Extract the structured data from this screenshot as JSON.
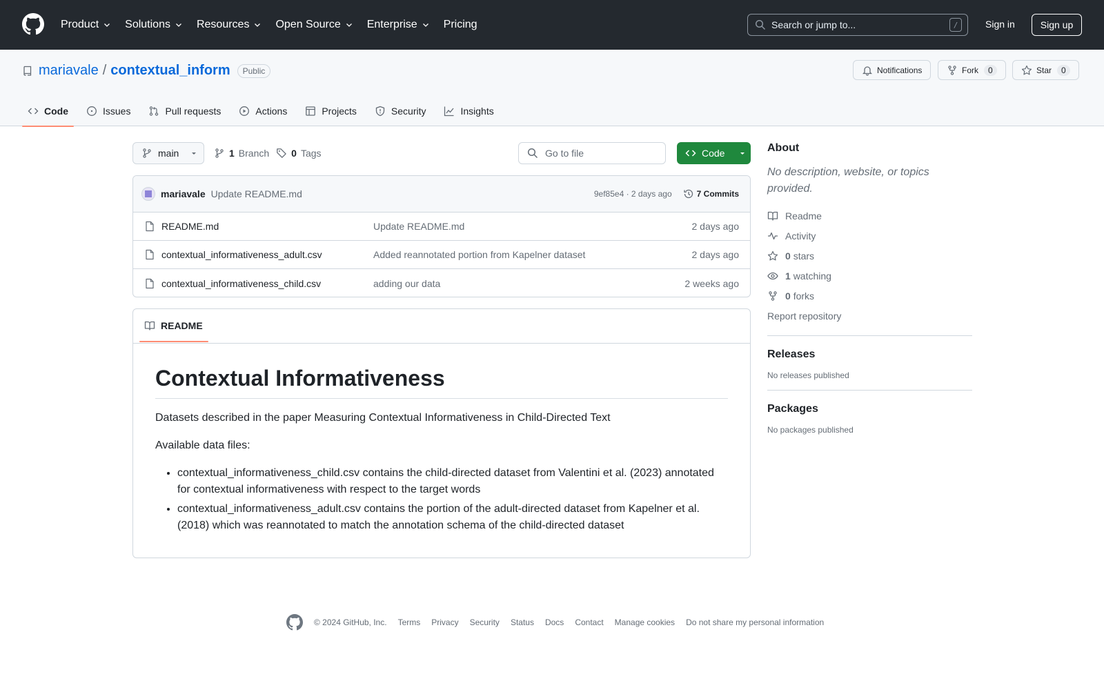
{
  "header": {
    "nav": [
      "Product",
      "Solutions",
      "Resources",
      "Open Source",
      "Enterprise",
      "Pricing"
    ],
    "search_placeholder": "Search or jump to...",
    "search_key": "/",
    "sign_in": "Sign in",
    "sign_up": "Sign up"
  },
  "repo": {
    "owner": "mariavale",
    "separator": "/",
    "name": "contextual_inform",
    "visibility": "Public",
    "notifications_label": "Notifications",
    "fork_label": "Fork",
    "fork_count": "0",
    "star_label": "Star",
    "star_count": "0"
  },
  "tabs": [
    {
      "label": "Code",
      "icon": "code-icon"
    },
    {
      "label": "Issues",
      "icon": "issue-icon"
    },
    {
      "label": "Pull requests",
      "icon": "pull-request-icon"
    },
    {
      "label": "Actions",
      "icon": "play-icon"
    },
    {
      "label": "Projects",
      "icon": "table-icon"
    },
    {
      "label": "Security",
      "icon": "shield-icon"
    },
    {
      "label": "Insights",
      "icon": "graph-icon"
    }
  ],
  "toolbar": {
    "branch": "main",
    "branch_count": "1",
    "branch_label": "Branch",
    "tag_count": "0",
    "tag_label": "Tags",
    "goto_placeholder": "Go to file",
    "code_label": "Code"
  },
  "commit": {
    "author": "mariavale",
    "message": "Update README.md",
    "meta": "9ef85e4 · 2 days ago",
    "commits": "7 Commits"
  },
  "files": [
    {
      "name": "README.md",
      "message": "Update README.md",
      "date": "2 days ago"
    },
    {
      "name": "contextual_informativeness_adult.csv",
      "message": "Added reannotated portion from Kapelner dataset",
      "date": "2 days ago"
    },
    {
      "name": "contextual_informativeness_child.csv",
      "message": "adding our data",
      "date": "2 weeks ago"
    }
  ],
  "readme": {
    "tab_label": "README",
    "title": "Contextual Informativeness",
    "p1": "Datasets described in the paper Measuring Contextual Informativeness in Child-Directed Text",
    "p2": "Available data files:",
    "items": [
      "contextual_informativeness_child.csv contains the child-directed dataset from Valentini et al. (2023) annotated for contextual informativeness with respect to the target words",
      "contextual_informativeness_adult.csv contains the portion of the adult-directed dataset from Kapelner et al. (2018) which was reannotated to match the annotation schema of the child-directed dataset"
    ]
  },
  "about": {
    "heading": "About",
    "description": "No description, website, or topics provided.",
    "readme": "Readme",
    "activity": "Activity",
    "stars_count": "0",
    "stars_label": "stars",
    "watching_count": "1",
    "watching_label": "watching",
    "forks_count": "0",
    "forks_label": "forks",
    "report": "Report repository"
  },
  "releases": {
    "heading": "Releases",
    "text": "No releases published"
  },
  "packages": {
    "heading": "Packages",
    "text": "No packages published"
  },
  "footer": {
    "copyright": "© 2024 GitHub, Inc.",
    "links": [
      "Terms",
      "Privacy",
      "Security",
      "Status",
      "Docs",
      "Contact",
      "Manage cookies",
      "Do not share my personal information"
    ]
  },
  "colors": {
    "header_bg": "#24292f",
    "link": "#0969da",
    "primary_button": "#1f883d",
    "active_tab_underline": "#fd8c73"
  }
}
